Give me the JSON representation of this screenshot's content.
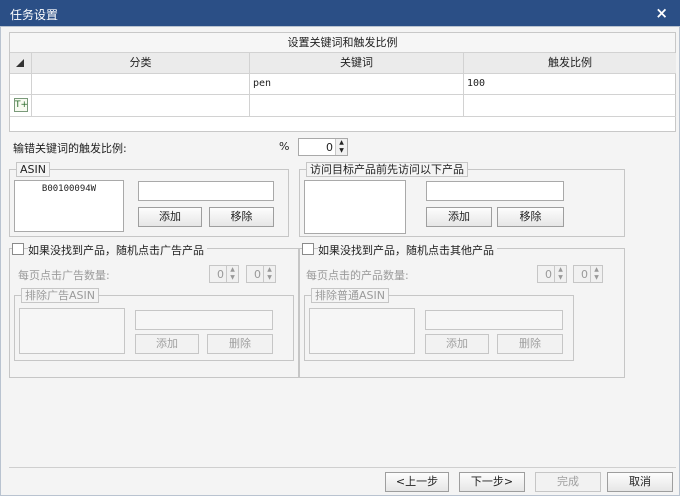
{
  "window": {
    "title": "任务设置",
    "close": "×"
  },
  "grid": {
    "caption": "设置关键词和触发比例",
    "columns": [
      "分类",
      "关键词",
      "触发比例"
    ],
    "rows": [
      {
        "category": "",
        "keyword": "pen",
        "ratio": "100"
      }
    ],
    "add_row_icon": "table-add-icon"
  },
  "miss_ratio": {
    "label": "输错关键词的触发比例:",
    "unit": "%",
    "value": "0"
  },
  "asin_group": {
    "legend": "ASIN",
    "items": [
      "B00100094W"
    ],
    "input_value": "",
    "add": "添加",
    "remove": "移除"
  },
  "visit_group": {
    "legend": "访问目标产品前先访问以下产品",
    "input_value": "",
    "add": "添加",
    "remove": "移除"
  },
  "ad_group": {
    "check_label": "如果没找到产品，随机点击广告产品",
    "per_page_label": "每页点击广告数量:",
    "spin_from": "0",
    "spin_to": "0",
    "exclude_legend": "排除广告ASIN",
    "add": "添加",
    "delete": "删除"
  },
  "other_group": {
    "check_label": "如果没找到产品，随机点击其他产品",
    "per_page_label": "每页点击的产品数量:",
    "spin_from": "0",
    "spin_to": "0",
    "exclude_legend": "排除普通ASIN",
    "add": "添加",
    "delete": "删除"
  },
  "footer": {
    "prev": "<上一步",
    "next": "下一步>",
    "finish": "完成",
    "cancel": "取消"
  }
}
